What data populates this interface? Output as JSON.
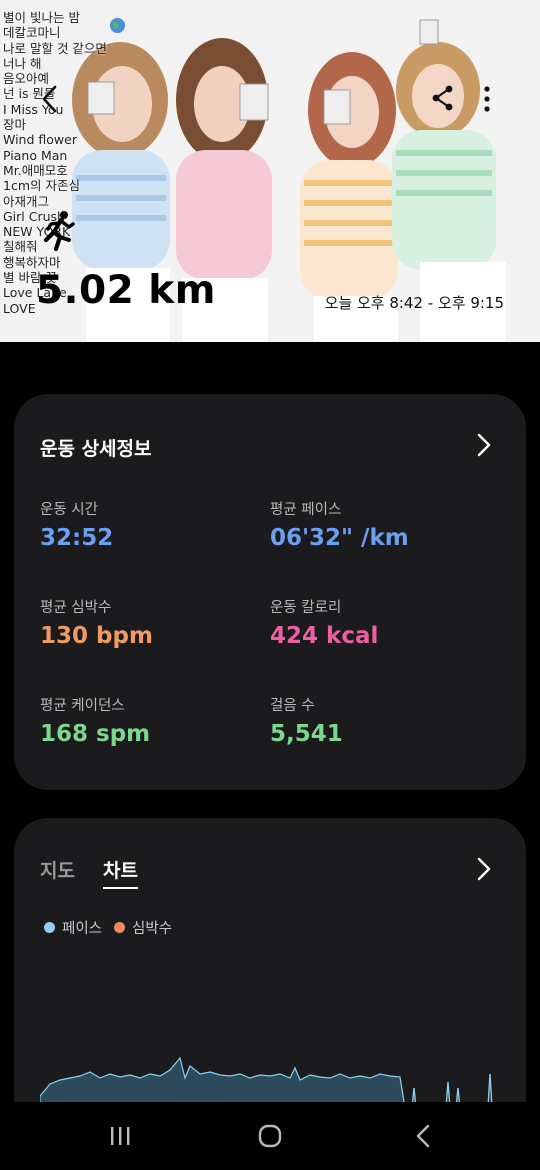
{
  "playlist": [
    "별이 빛나는 밤",
    "데칼코마니",
    "나로 말할 것 같으면",
    "너나 해",
    "음오아예",
    "넌 is 뭔들",
    "I Miss You",
    "장마",
    "Wind flower",
    "Piano Man",
    "Mr.애매모호",
    "1cm의 자존심",
    "아재개그",
    "Girl Crush",
    "NEW YORK",
    "칠해줘",
    "행복하자마",
    "별 바람 꽃",
    "Love Lane",
    "LOVE"
  ],
  "header": {
    "distance": "5.02 km",
    "time_range": "오늘 오후 8:42 - 오후 9:15",
    "back_icon": "chevron-left-icon",
    "share_icon": "share-icon",
    "more_icon": "more-vertical-icon",
    "activity_icon": "running-icon"
  },
  "details": {
    "title": "운동 상세정보",
    "metrics": [
      {
        "label": "운동 시간",
        "value": "32:52",
        "color": "#6c9ef2"
      },
      {
        "label": "평균 페이스",
        "value": "06'32\" /km",
        "color": "#6c9ef2"
      },
      {
        "label": "평균 심박수",
        "value": "130 bpm",
        "color": "#ef9a63"
      },
      {
        "label": "운동 칼로리",
        "value": "424 kcal",
        "color": "#ec5fa0"
      },
      {
        "label": "평균 케이던스",
        "value": "168 spm",
        "color": "#7bd88e"
      },
      {
        "label": "걸음 수",
        "value": "5,541",
        "color": "#7bd88e"
      }
    ]
  },
  "chart_card": {
    "tabs": [
      {
        "label": "지도",
        "active": false
      },
      {
        "label": "차트",
        "active": true
      }
    ],
    "legend": [
      {
        "label": "페이스",
        "color": "#8fd0f0"
      },
      {
        "label": "심박수",
        "color": "#ef8a5a"
      }
    ]
  },
  "navbar": {
    "icons": [
      "recent-apps-icon",
      "home-icon",
      "back-icon"
    ]
  }
}
